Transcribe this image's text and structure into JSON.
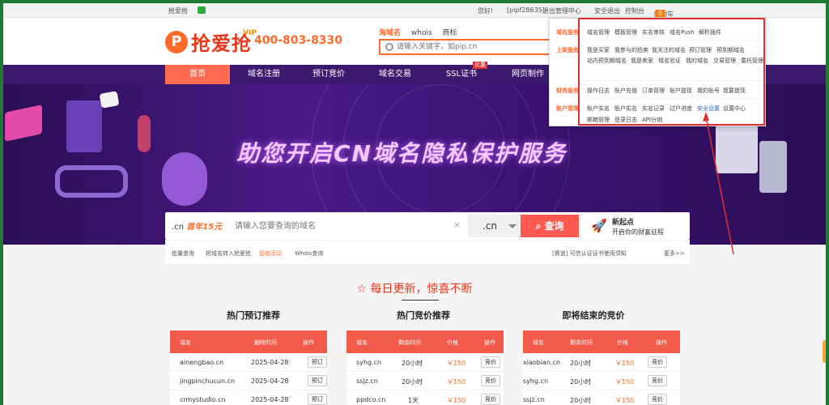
{
  "topbar": {
    "items": [
      "抢爱抢",
      "您好!",
      "[pipf28635]",
      "退出",
      "管理中心",
      "安全退出",
      "控制台",
      "购物车"
    ],
    "cart_count": "0"
  },
  "header": {
    "logo_text": "抢爱抢",
    "logo_letter": "P",
    "vip": "VIP",
    "phone": "400-803-8330",
    "search_tabs": [
      "淘域名",
      "whois",
      "商标"
    ],
    "search_placeholder": "请输入关键字，如pip.cn"
  },
  "nav": {
    "items": [
      "首页",
      "域名注册",
      "预订竞价",
      "域名交易",
      "SSL证书",
      "网页制作"
    ],
    "badge": "优惠"
  },
  "banner": {
    "title": "助您开启CN域名隐私保护服务"
  },
  "domain_search": {
    "tld_label": ".cn",
    "promo": "首年15元",
    "placeholder": "请输入您要查询的域名",
    "clear": "×",
    "tld_select": ".cn",
    "button": "查询",
    "new_start_title": "新起点",
    "new_start_sub": "开启你的财富征程"
  },
  "sublinks": {
    "items": [
      "批量查询",
      "把域名转入抢爱抢",
      "促销活动",
      "Whois查询"
    ],
    "notice": "[赛道] 可信认证证书使用须知",
    "more": "更多>>"
  },
  "daily": "每日更新，惊喜不断",
  "sections": [
    {
      "title": "热门预订推荐",
      "headers": [
        "域名",
        "删除时间",
        "操作"
      ],
      "rows": [
        {
          "name": "ainengbao.cn",
          "time": "2025-04-28",
          "action": "预订"
        },
        {
          "name": "jingpinchucun.cn",
          "time": "2025-04-28",
          "action": "预订"
        },
        {
          "name": "crmystudio.cn",
          "time": "2025-04-28",
          "action": "预订"
        }
      ]
    },
    {
      "title": "热门竞价推荐",
      "headers": [
        "域名",
        "剩余时间",
        "价格",
        "操作"
      ],
      "rows": [
        {
          "name": "syhg.cn",
          "time": "20小时",
          "price": "￥150",
          "action": "竞价"
        },
        {
          "name": "ssjz.cn",
          "time": "20小时",
          "price": "￥150",
          "action": "竞价"
        },
        {
          "name": "ppdco.cn",
          "time": "1天",
          "price": "￥150",
          "action": "竞价"
        }
      ]
    },
    {
      "title": "即将结束的竞价",
      "headers": [
        "域名",
        "剩余时间",
        "价格",
        "操作"
      ],
      "rows": [
        {
          "name": "xiaobian.cn",
          "time": "20小时",
          "price": "￥150",
          "action": "竞价"
        },
        {
          "name": "syhg.cn",
          "time": "20小时",
          "price": "￥150",
          "action": "竞价"
        },
        {
          "name": "ssjz.cn",
          "time": "20小时",
          "price": "￥150",
          "action": "竞价"
        }
      ]
    }
  ],
  "dropdown": {
    "groups": [
      {
        "label": "域名服务",
        "items": [
          "域名管理",
          "模板管理",
          "实名审核",
          "域名Push",
          "解析插件"
        ]
      },
      {
        "label": "上架服务",
        "items": [
          "我是买家",
          "我参与的拍卖",
          "我关注的域名",
          "预订管理",
          "预到期域名",
          "站内预到期域名",
          "我是卖家",
          "域名验证",
          "我的域名",
          "交易管理",
          "委托管理"
        ]
      },
      {
        "label": "财务服务",
        "items": [
          "操作日志",
          "账户充值",
          "订单管理",
          "账户提现",
          "我的账号",
          "我要提现"
        ]
      },
      {
        "label": "账户管理",
        "items": [
          "账户实名",
          "账户实名",
          "实名记录",
          "过户进度",
          "安全设置",
          "设置中心",
          "邮箱管理",
          "登录日志",
          "API分销"
        ]
      }
    ]
  }
}
